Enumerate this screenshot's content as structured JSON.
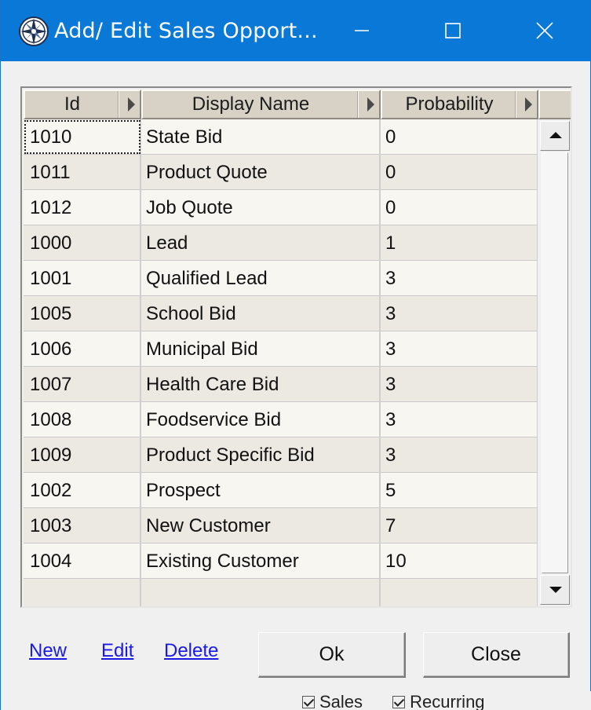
{
  "window": {
    "title": "Add/ Edit Sales Opport...",
    "title_bar_color": "#0a78d7"
  },
  "grid": {
    "columns": [
      "Id",
      "Display Name",
      "Probability"
    ],
    "rows": [
      {
        "id": "1010",
        "name": "State Bid",
        "prob": "0"
      },
      {
        "id": "1011",
        "name": "Product Quote",
        "prob": "0"
      },
      {
        "id": "1012",
        "name": "Job Quote",
        "prob": "0"
      },
      {
        "id": "1000",
        "name": "Lead",
        "prob": "1"
      },
      {
        "id": "1001",
        "name": "Qualified Lead",
        "prob": "3"
      },
      {
        "id": "1005",
        "name": "School Bid",
        "prob": "3"
      },
      {
        "id": "1006",
        "name": "Municipal Bid",
        "prob": "3"
      },
      {
        "id": "1007",
        "name": "Health Care Bid",
        "prob": "3"
      },
      {
        "id": "1008",
        "name": "Foodservice Bid",
        "prob": "3"
      },
      {
        "id": "1009",
        "name": "Product Specific Bid",
        "prob": "3"
      },
      {
        "id": "1002",
        "name": "Prospect",
        "prob": "5"
      },
      {
        "id": "1003",
        "name": "New Customer",
        "prob": "7"
      },
      {
        "id": "1004",
        "name": "Existing Customer",
        "prob": "10"
      }
    ]
  },
  "links": {
    "new": "New",
    "edit": "Edit",
    "delete": "Delete"
  },
  "buttons": {
    "ok": "Ok",
    "close": "Close"
  },
  "background_window": {
    "items": [
      "Sales",
      "Recurring"
    ]
  },
  "icons": {
    "app": "compass-icon",
    "minimize": "minimize-icon",
    "maximize": "maximize-icon",
    "close": "close-icon",
    "scroll_up": "scroll-up-arrow-icon",
    "scroll_down": "scroll-down-arrow-icon",
    "column_menu": "column-arrow-icon"
  }
}
